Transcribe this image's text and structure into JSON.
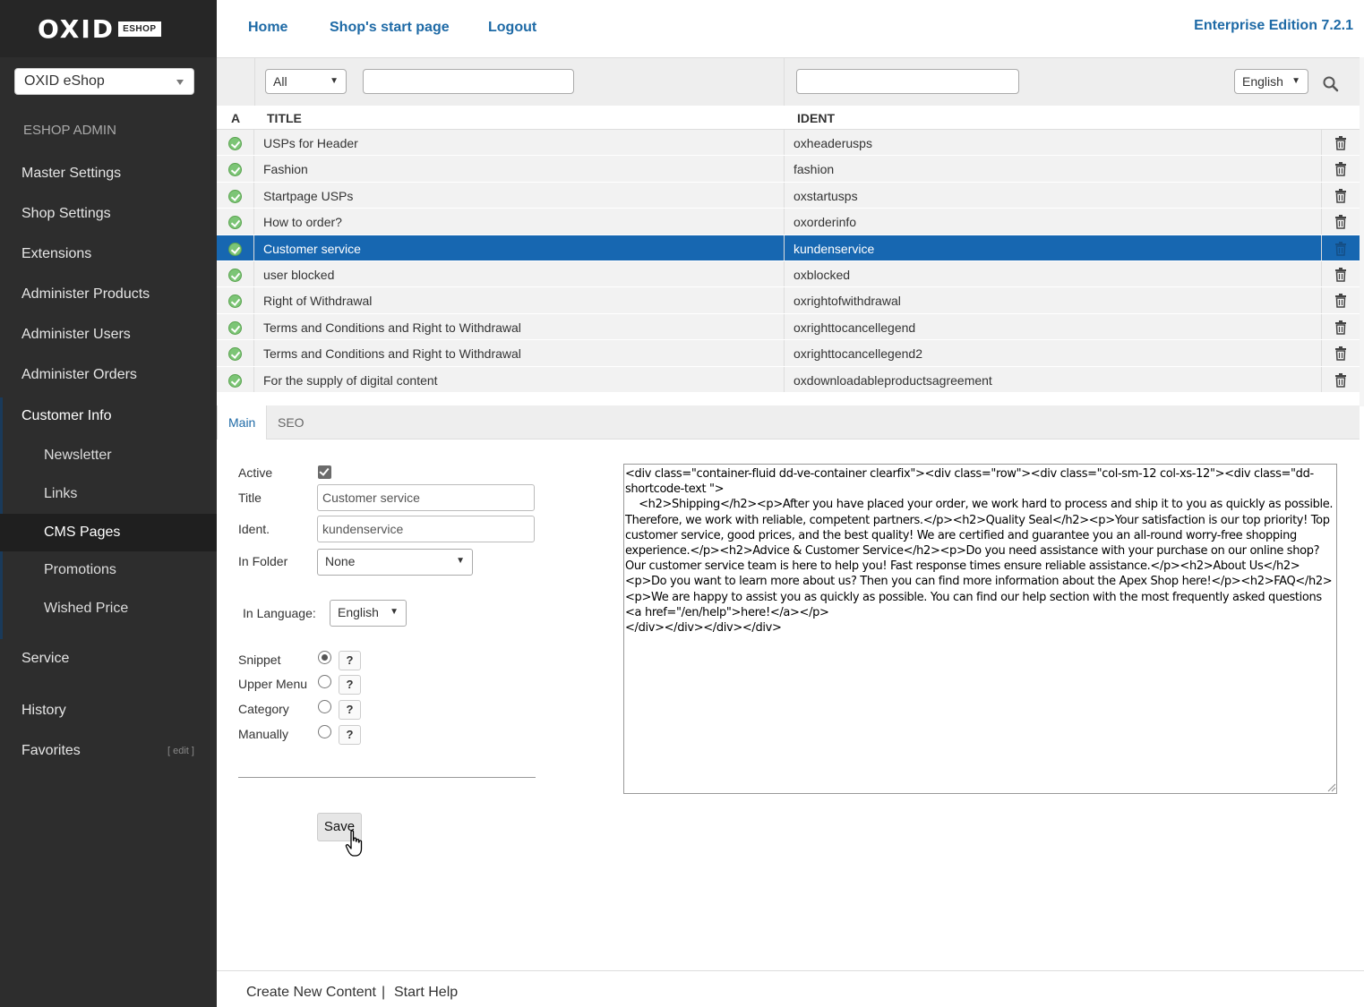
{
  "sidebar": {
    "logo_text": "OXID",
    "logo_badge": "ESHOP",
    "shop_select": "OXID eShop",
    "section_title": "ESHOP ADMIN",
    "items": [
      {
        "label": "Master Settings"
      },
      {
        "label": "Shop Settings"
      },
      {
        "label": "Extensions"
      },
      {
        "label": "Administer Products"
      },
      {
        "label": "Administer Users"
      },
      {
        "label": "Administer Orders"
      },
      {
        "label": "Customer Info"
      },
      {
        "label": "Service"
      },
      {
        "label": "History"
      },
      {
        "label": "Favorites"
      }
    ],
    "customer_sub_items": [
      {
        "label": "Newsletter"
      },
      {
        "label": "Links"
      },
      {
        "label": "CMS Pages"
      },
      {
        "label": "Promotions"
      },
      {
        "label": "Wished Price"
      }
    ],
    "favorites_edit": "[ edit ]"
  },
  "header": {
    "links": [
      "Home",
      "Shop's start page",
      "Logout"
    ],
    "edition": "Enterprise Edition 7.2.1"
  },
  "filter": {
    "folder_select": "All",
    "language_select": "English"
  },
  "table": {
    "headers": {
      "active": "A",
      "title": "TITLE",
      "ident": "IDENT"
    },
    "rows": [
      {
        "title": "USPs for Header",
        "ident": "oxheaderusps",
        "active": true
      },
      {
        "title": "Fashion",
        "ident": "fashion",
        "active": true
      },
      {
        "title": "Startpage USPs",
        "ident": "oxstartusps",
        "active": true
      },
      {
        "title": "How to order?",
        "ident": "oxorderinfo",
        "active": true
      },
      {
        "title": "Customer service",
        "ident": "kundenservice",
        "active": true,
        "selected": true
      },
      {
        "title": "user blocked",
        "ident": "oxblocked",
        "active": true
      },
      {
        "title": "Right of Withdrawal",
        "ident": "oxrightofwithdrawal",
        "active": true
      },
      {
        "title": "Terms and Conditions and Right to Withdrawal",
        "ident": "oxrighttocancellegend",
        "active": true
      },
      {
        "title": "Terms and Conditions and Right to Withdrawal",
        "ident": "oxrighttocancellegend2",
        "active": true
      },
      {
        "title": "For the supply of digital content",
        "ident": "oxdownloadableproductsagreement",
        "active": true
      }
    ]
  },
  "tabs": [
    "Main",
    "SEO"
  ],
  "form": {
    "active_label": "Active",
    "active_checked": true,
    "title_label": "Title",
    "title_value": "Customer service",
    "ident_label": "Ident.",
    "ident_value": "kundenservice",
    "folder_label": "In Folder",
    "folder_value": "None",
    "language_label": "In Language:",
    "language_value": "English",
    "types": [
      {
        "label": "Snippet",
        "checked": true
      },
      {
        "label": "Upper Menu",
        "checked": false
      },
      {
        "label": "Category",
        "checked": false
      },
      {
        "label": "Manually",
        "checked": false
      }
    ],
    "help_label": "?",
    "save_label": "Save"
  },
  "content_html": "<div class=\"container-fluid dd-ve-container clearfix\"><div class=\"row\"><div class=\"col-sm-12 col-xs-12\"><div class=\"dd-shortcode-text \">\n    <h2>Shipping</h2><p>After you have placed your order, we work hard to process and ship it to you as quickly as possible. Therefore, we work with reliable, competent partners.</p><h2>Quality Seal</h2><p>Your satisfaction is our top priority! Top customer service, good prices, and the best quality! We are certified and guarantee you an all-round worry-free shopping experience.</p><h2>Advice & Customer Service</h2><p>Do you need assistance with your purchase on our online shop? Our customer service team is here to help you! Fast response times ensure reliable assistance.</p><h2>About Us</h2><p>Do you want to learn more about us? Then you can find more information about the Apex Shop here!</p><h2>FAQ</h2><p>We are happy to assist you as quickly as possible. You can find our help section with the most frequently asked questions <a href=\"/en/help\">here!</a></p>\n</div></div></div></div>",
  "footer": {
    "create": "Create New Content",
    "separator": "|",
    "help": "Start Help"
  },
  "colors": {
    "sidebar_bg": "#2d2d2d",
    "accent": "#1e6aa6",
    "selected_row": "#1767b1",
    "status_active": "#7cc576"
  }
}
